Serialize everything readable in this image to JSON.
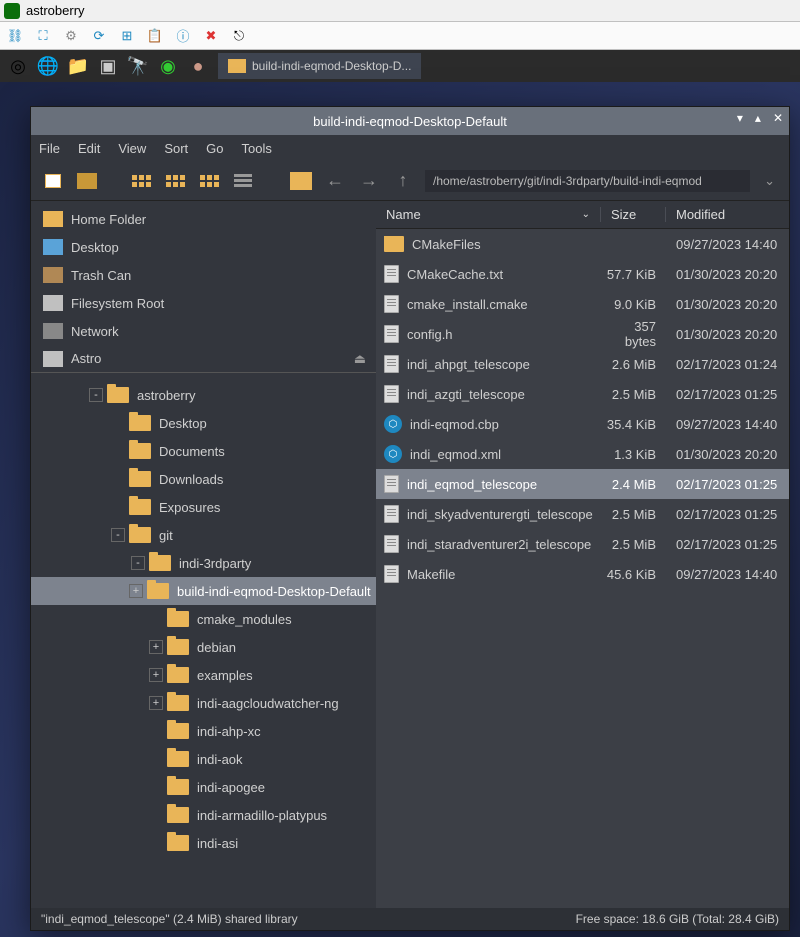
{
  "vnc": {
    "title": "astroberry"
  },
  "taskbar": {
    "button": "build-indi-eqmod-Desktop-D..."
  },
  "window": {
    "title": "build-indi-eqmod-Desktop-Default",
    "menu": [
      "File",
      "Edit",
      "View",
      "Sort",
      "Go",
      "Tools"
    ],
    "path": "/home/astroberry/git/indi-3rdparty/build-indi-eqmod"
  },
  "places": [
    {
      "label": "Home Folder",
      "icon": "home"
    },
    {
      "label": "Desktop",
      "icon": "desk"
    },
    {
      "label": "Trash Can",
      "icon": "trash"
    },
    {
      "label": "Filesystem Root",
      "icon": "fs"
    },
    {
      "label": "Network",
      "icon": "net"
    },
    {
      "label": "Astro",
      "icon": "fs",
      "eject": true
    }
  ],
  "tree": [
    {
      "indent": 1,
      "label": "astroberry",
      "exp": "-",
      "top_cut": true
    },
    {
      "indent": 2,
      "label": "Desktop"
    },
    {
      "indent": 2,
      "label": "Documents"
    },
    {
      "indent": 2,
      "label": "Downloads"
    },
    {
      "indent": 2,
      "label": "Exposures"
    },
    {
      "indent": 2,
      "label": "git",
      "exp": "-"
    },
    {
      "indent": 3,
      "label": "indi-3rdparty",
      "exp": "-"
    },
    {
      "indent": 4,
      "label": "build-indi-eqmod-Desktop-Default",
      "exp": "+",
      "sel": true
    },
    {
      "indent": 5,
      "label": "cmake_modules"
    },
    {
      "indent": 5,
      "label": "debian",
      "exp": "+"
    },
    {
      "indent": 5,
      "label": "examples",
      "exp": "+"
    },
    {
      "indent": 5,
      "label": "indi-aagcloudwatcher-ng",
      "exp": "+"
    },
    {
      "indent": 5,
      "label": "indi-ahp-xc"
    },
    {
      "indent": 5,
      "label": "indi-aok"
    },
    {
      "indent": 5,
      "label": "indi-apogee"
    },
    {
      "indent": 5,
      "label": "indi-armadillo-platypus"
    },
    {
      "indent": 5,
      "label": "indi-asi"
    }
  ],
  "columns": {
    "name": "Name",
    "size": "Size",
    "modified": "Modified"
  },
  "files": [
    {
      "name": "CMakeFiles",
      "type": "folder",
      "size": "",
      "modified": "09/27/2023 14:40"
    },
    {
      "name": "CMakeCache.txt",
      "type": "file",
      "size": "57.7 KiB",
      "modified": "01/30/2023 20:20"
    },
    {
      "name": "cmake_install.cmake",
      "type": "file",
      "size": "9.0 KiB",
      "modified": "01/30/2023 20:20"
    },
    {
      "name": "config.h",
      "type": "file",
      "size": "357 bytes",
      "modified": "01/30/2023 20:20"
    },
    {
      "name": "indi_ahpgt_telescope",
      "type": "file",
      "size": "2.6 MiB",
      "modified": "02/17/2023 01:24"
    },
    {
      "name": "indi_azgti_telescope",
      "type": "file",
      "size": "2.5 MiB",
      "modified": "02/17/2023 01:25"
    },
    {
      "name": "indi-eqmod.cbp",
      "type": "cbp",
      "size": "35.4 KiB",
      "modified": "09/27/2023 14:40"
    },
    {
      "name": "indi_eqmod.xml",
      "type": "cbp",
      "size": "1.3 KiB",
      "modified": "01/30/2023 20:20"
    },
    {
      "name": "indi_eqmod_telescope",
      "type": "file",
      "size": "2.4 MiB",
      "modified": "02/17/2023 01:25",
      "sel": true
    },
    {
      "name": "indi_skyadventurergti_telescope",
      "type": "file",
      "size": "2.5 MiB",
      "modified": "02/17/2023 01:25"
    },
    {
      "name": "indi_staradventurer2i_telescope",
      "type": "file",
      "size": "2.5 MiB",
      "modified": "02/17/2023 01:25"
    },
    {
      "name": "Makefile",
      "type": "file",
      "size": "45.6 KiB",
      "modified": "09/27/2023 14:40"
    }
  ],
  "status": {
    "left": "\"indi_eqmod_telescope\" (2.4 MiB) shared library",
    "right": "Free space: 18.6 GiB (Total: 28.4 GiB)"
  }
}
